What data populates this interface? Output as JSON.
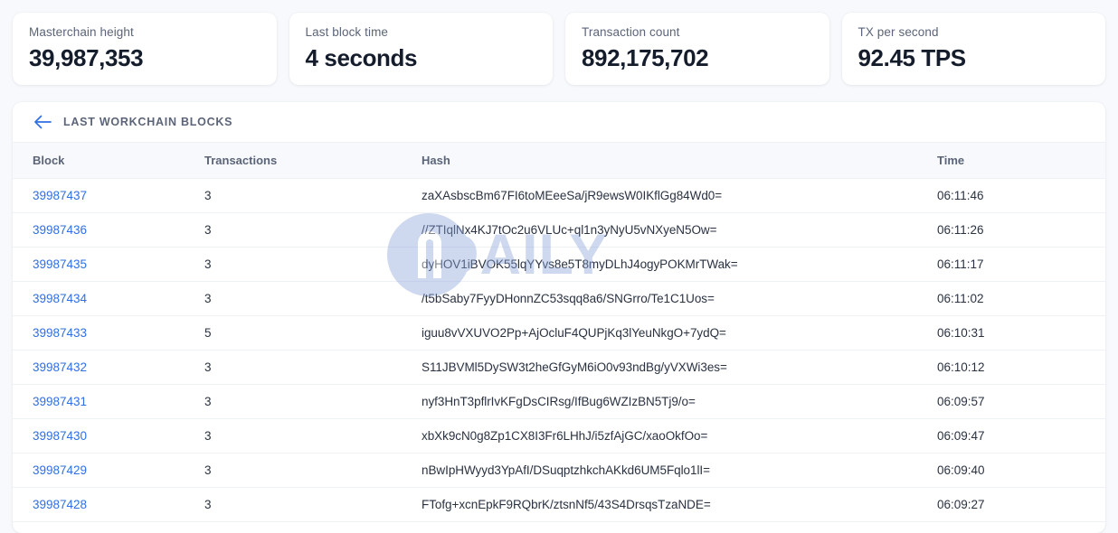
{
  "stats": [
    {
      "label": "Masterchain height",
      "value": "39,987,353"
    },
    {
      "label": "Last block time",
      "value": "4 seconds"
    },
    {
      "label": "Transaction count",
      "value": "892,175,702"
    },
    {
      "label": "TX per second",
      "value": "92.45 TPS"
    }
  ],
  "panel": {
    "title": "LAST WORKCHAIN BLOCKS",
    "back_icon": "arrow-left-icon",
    "accent_color": "#2f6fe4"
  },
  "table": {
    "columns": [
      "Block",
      "Transactions",
      "Hash",
      "Time"
    ],
    "rows": [
      {
        "block": "39987437",
        "transactions": "3",
        "hash": "zaXAsbscBm67FI6toMEeeSa/jR9ewsW0IKflGg84Wd0=",
        "time": "06:11:46"
      },
      {
        "block": "39987436",
        "transactions": "3",
        "hash": "//ZTIqlNx4KJ7tOc2u6VLUc+ql1n3yNyU5vNXyeN5Ow=",
        "time": "06:11:26"
      },
      {
        "block": "39987435",
        "transactions": "3",
        "hash": "dyHOV1iBVOK55lqYYvs8e5T8myDLhJ4ogyPOKMrTWak=",
        "time": "06:11:17"
      },
      {
        "block": "39987434",
        "transactions": "3",
        "hash": "/t5bSaby7FyyDHonnZC53sqq8a6/SNGrro/Te1C1Uos=",
        "time": "06:11:02"
      },
      {
        "block": "39987433",
        "transactions": "5",
        "hash": "iguu8vVXUVO2Pp+AjOcluF4QUPjKq3lYeuNkgO+7ydQ=",
        "time": "06:10:31"
      },
      {
        "block": "39987432",
        "transactions": "3",
        "hash": "S11JBVMl5DySW3t2heGfGyM6iO0v93ndBg/yVXWi3es=",
        "time": "06:10:12"
      },
      {
        "block": "39987431",
        "transactions": "3",
        "hash": "nyf3HnT3pflrIvKFgDsCIRsg/IfBug6WZIzBN5Tj9/o=",
        "time": "06:09:57"
      },
      {
        "block": "39987430",
        "transactions": "3",
        "hash": "xbXk9cN0g8Zp1CX8I3Fr6LHhJ/i5zfAjGC/xaoOkfOo=",
        "time": "06:09:47"
      },
      {
        "block": "39987429",
        "transactions": "3",
        "hash": "nBwIpHWyyd3YpAfI/DSuqptzhkchAKkd6UM5Fqlo1lI=",
        "time": "06:09:40"
      },
      {
        "block": "39987428",
        "transactions": "3",
        "hash": "FTofg+xcnEpkF9RQbrK/ztsnNf5/43S4DrsqsTzaNDE=",
        "time": "06:09:27"
      }
    ]
  },
  "watermark": {
    "text": "DAILY",
    "color": "#8ba4d8"
  }
}
